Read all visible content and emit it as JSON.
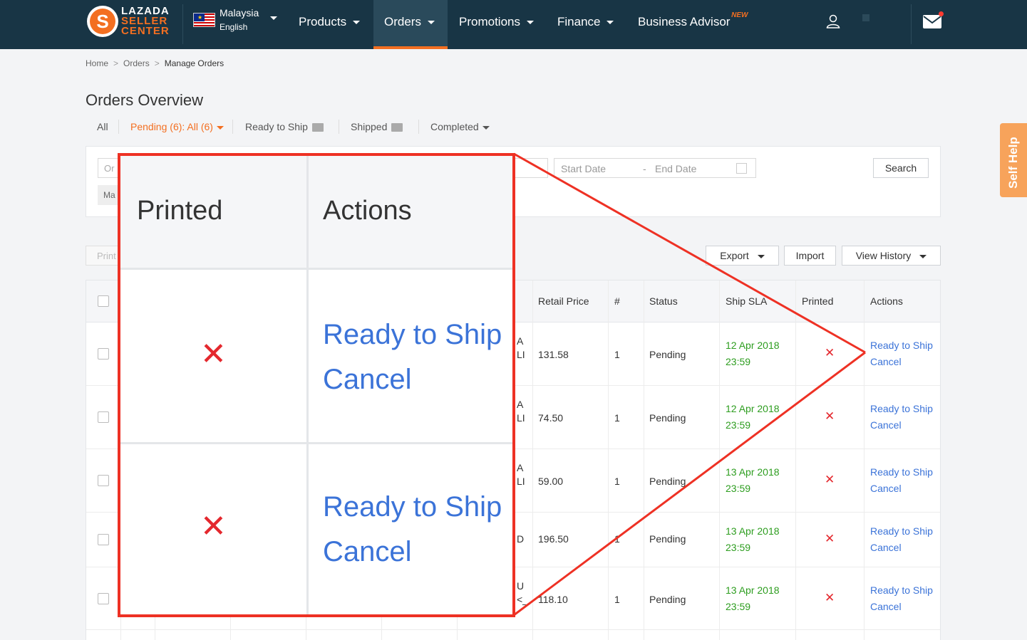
{
  "brand": {
    "line1": "LAZADA",
    "line2": "SELLER",
    "line3": "CENTER",
    "logo_letter": "S",
    "accent_color": "#f36f21",
    "nav_bg_color": "#183545"
  },
  "language": {
    "country": "Malaysia",
    "language": "English"
  },
  "nav": {
    "items": [
      {
        "label": "Products"
      },
      {
        "label": "Orders"
      },
      {
        "label": "Promotions"
      },
      {
        "label": "Finance"
      },
      {
        "label": "Business Advisor",
        "badge": "NEW"
      }
    ]
  },
  "breadcrumb": [
    "Home",
    "Orders",
    "Manage Orders"
  ],
  "page_title": "Orders Overview",
  "tabs": {
    "all": "All",
    "pending": "Pending",
    "pending_count": "(6)",
    "pending_sub": ": All (6)",
    "ready": "Ready to Ship",
    "shipped": "Shipped",
    "completed": "Completed"
  },
  "filters": {
    "order_input_fragment": "Or",
    "chip_fragment": "Ma",
    "start_date_placeholder": "Start Date",
    "date_separator": "-",
    "end_date_placeholder": "End Date",
    "search_label": "Search"
  },
  "toolbar": {
    "print_fragment": "Print",
    "export_label": "Export",
    "import_label": "Import",
    "history_label": "View History"
  },
  "table": {
    "headers": {
      "retail_price": "Retail Price",
      "qty": "#",
      "status": "Status",
      "ship_sla": "Ship SLA",
      "printed": "Printed",
      "actions": "Actions"
    },
    "rows": [
      {
        "clip1": "A",
        "clip2": "LI",
        "price": "131.58",
        "qty": "1",
        "status": "Pending",
        "sla_date": "12 Apr 2018",
        "sla_time": "23:59",
        "printed": "✕",
        "action1": "Ready to Ship",
        "action2": "Cancel"
      },
      {
        "clip1": "A",
        "clip2": "LI",
        "price": "74.50",
        "qty": "1",
        "status": "Pending",
        "sla_date": "12 Apr 2018",
        "sla_time": "23:59",
        "printed": "✕",
        "action1": "Ready to Ship",
        "action2": "Cancel"
      },
      {
        "clip1": "A",
        "clip2": "LI",
        "price": "59.00",
        "qty": "1",
        "status": "Pending",
        "sla_date": "13 Apr 2018",
        "sla_time": "23:59",
        "printed": "✕",
        "action1": "Ready to Ship",
        "action2": "Cancel"
      },
      {
        "clip1": "D",
        "clip2": "",
        "price": "196.50",
        "qty": "1",
        "status": "Pending",
        "sla_date": "13 Apr 2018",
        "sla_time": "23:59",
        "printed": "✕",
        "action1": "Ready to Ship",
        "action2": "Cancel"
      },
      {
        "clip1": "U",
        "clip2": "<_",
        "price": "118.10",
        "qty": "1",
        "status": "Pending",
        "sla_date": "13 Apr 2018",
        "sla_time": "23:59",
        "printed": "✕",
        "action1": "Ready to Ship",
        "action2": "Cancel"
      }
    ]
  },
  "zoom": {
    "printed_header": "Printed",
    "actions_header": "Actions",
    "rows": [
      {
        "printed": "✕",
        "action1": "Ready to Ship",
        "action2": "Cancel"
      },
      {
        "printed": "✕",
        "action1": "Ready to Ship",
        "action2": "Cancel"
      }
    ],
    "highlight_color": "#ee3124"
  },
  "self_help": "Self Help"
}
